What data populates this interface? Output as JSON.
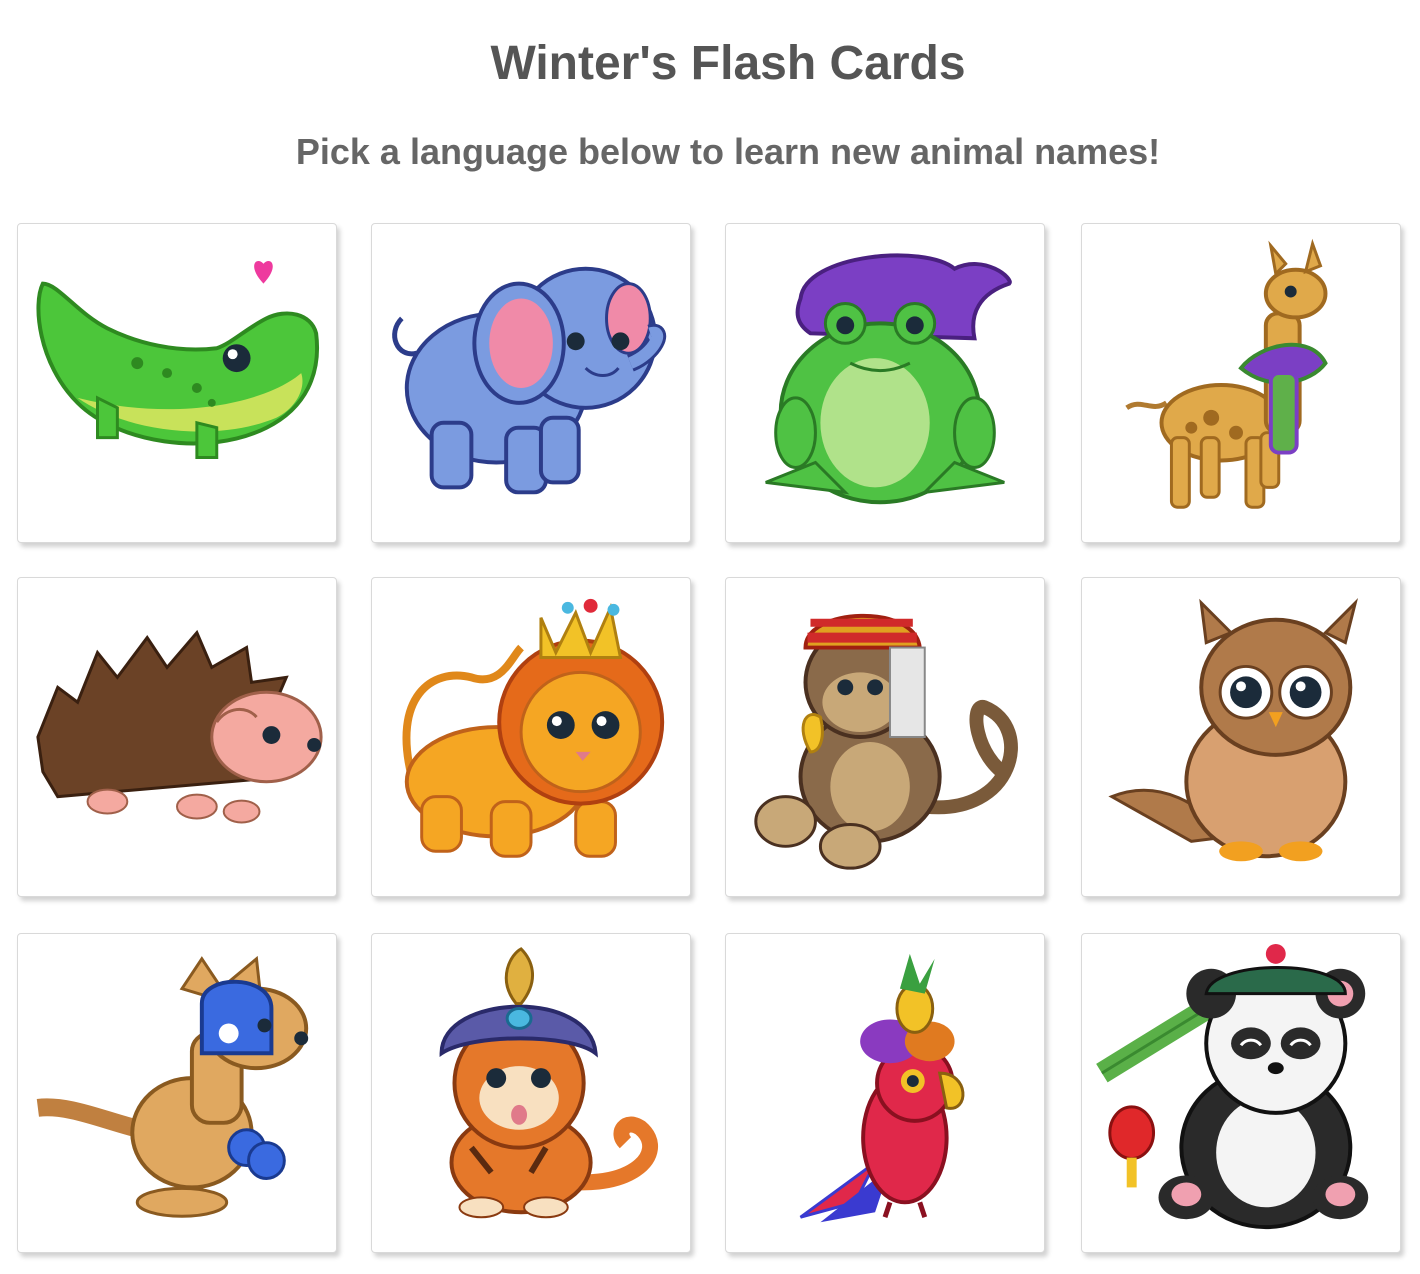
{
  "header": {
    "title": "Winter's Flash Cards",
    "subtitle": "Pick a language below to learn new animal names!"
  },
  "cards": [
    {
      "animal": "crocodile-icon",
      "accent": "#4cc63a"
    },
    {
      "animal": "elephant-icon",
      "accent": "#7b9be0"
    },
    {
      "animal": "frog-icon",
      "accent": "#4fc244"
    },
    {
      "animal": "giraffe-icon",
      "accent": "#e0a94a"
    },
    {
      "animal": "hedgehog-icon",
      "accent": "#6b4226"
    },
    {
      "animal": "lion-icon",
      "accent": "#f5a623"
    },
    {
      "animal": "monkey-icon",
      "accent": "#8a6a4a"
    },
    {
      "animal": "owl-icon",
      "accent": "#b07a4a"
    },
    {
      "animal": "kangaroo-icon",
      "accent": "#e0a860"
    },
    {
      "animal": "tiger-icon",
      "accent": "#e5782a"
    },
    {
      "animal": "parrot-icon",
      "accent": "#e0284a"
    },
    {
      "animal": "panda-icon",
      "accent": "#333333"
    }
  ]
}
